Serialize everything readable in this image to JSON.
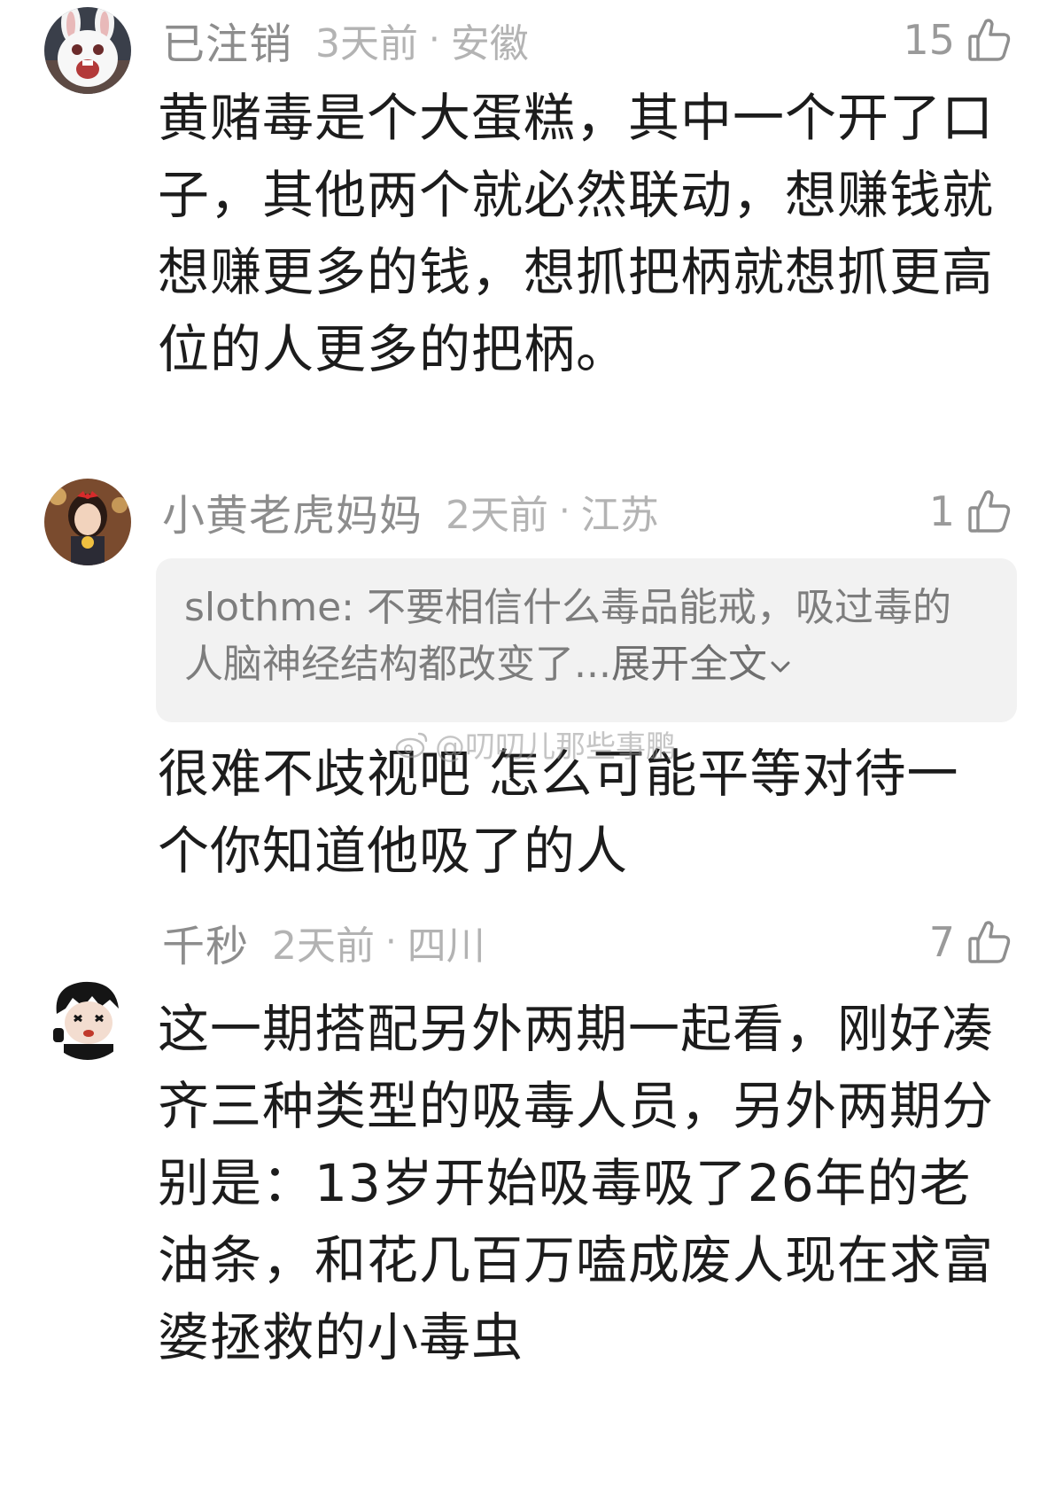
{
  "comments": [
    {
      "username": "已注销",
      "time": "3天前",
      "separator": "·",
      "location": "安徽",
      "likes": "15",
      "avatar_icon": "white-rabbit-avatar",
      "text": "黄赌毒是个大蛋糕，其中一个开了口子，其他两个就必然联动，想赚钱就想赚更多的钱，想抓把柄就想抓更高位的人更多的把柄。"
    },
    {
      "username": "小黄老虎妈妈",
      "time": "2天前",
      "separator": "·",
      "location": "江苏",
      "likes": "1",
      "avatar_icon": "girl-photo-avatar",
      "quote": {
        "user": "slothme",
        "colon": ":",
        "text": " 不要相信什么毒品能戒，吸过毒的人脑神经结构都改变了...",
        "expand": "展开全文"
      },
      "text": "很难不歧视吧 怎么可能平等对待一个你知道他吸了的人"
    },
    {
      "username": "千秒",
      "time": "2天前",
      "separator": "·",
      "location": "四川",
      "likes": "7",
      "avatar_icon": "cartoon-boy-avatar",
      "text": "这一期搭配另外两期一起看，刚好凑齐三种类型的吸毒人员，另外两期分别是：13岁开始吸毒吸了26年的老油条，和花几百万嗑成废人现在求富婆拯救的小毒虫"
    }
  ],
  "watermark": {
    "text": "@叨叨儿那些事鹏",
    "icon": "weibo-icon"
  },
  "colors": {
    "username": "#8d8d8d",
    "meta": "#b3b3b3",
    "body": "#1c1c1c",
    "quote_bg": "#f2f2f2"
  }
}
